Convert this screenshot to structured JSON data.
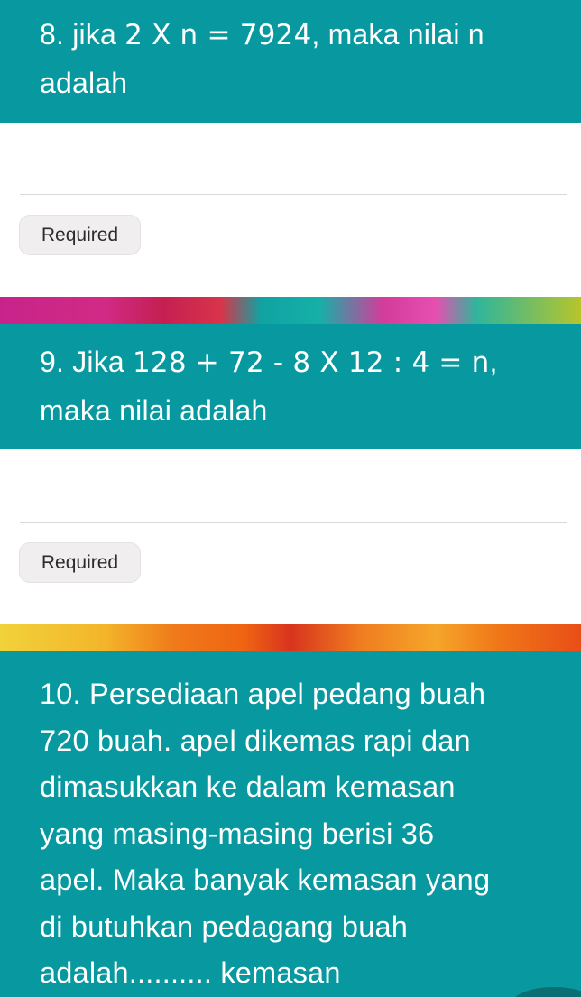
{
  "questions": [
    {
      "number": "8.",
      "text_before": "jika ",
      "math": "2 X n = 7924",
      "text_after": ", maka nilai n",
      "line2": "adalah",
      "required_label": "Required"
    },
    {
      "number": "9.",
      "text_before": "Jika ",
      "math": "128 + 72 - 8 X 12 : 4 = n",
      "text_after": ",",
      "line2": "maka nilai adalah",
      "required_label": "Required"
    },
    {
      "number": "10.",
      "lines": [
        "Persediaan apel pedang buah",
        "720 buah. apel dikemas rapi dan",
        "dimasukkan ke dalam kemasan",
        "yang masing-masing berisi 36",
        "apel. Maka banyak kemasan yang",
        "di butuhkan pedagang buah",
        "adalah.......... kemasan"
      ]
    }
  ],
  "colors": {
    "header_teal": "#07999f",
    "chip_bg": "#f0eeef",
    "divider": "#d9d9d9"
  }
}
